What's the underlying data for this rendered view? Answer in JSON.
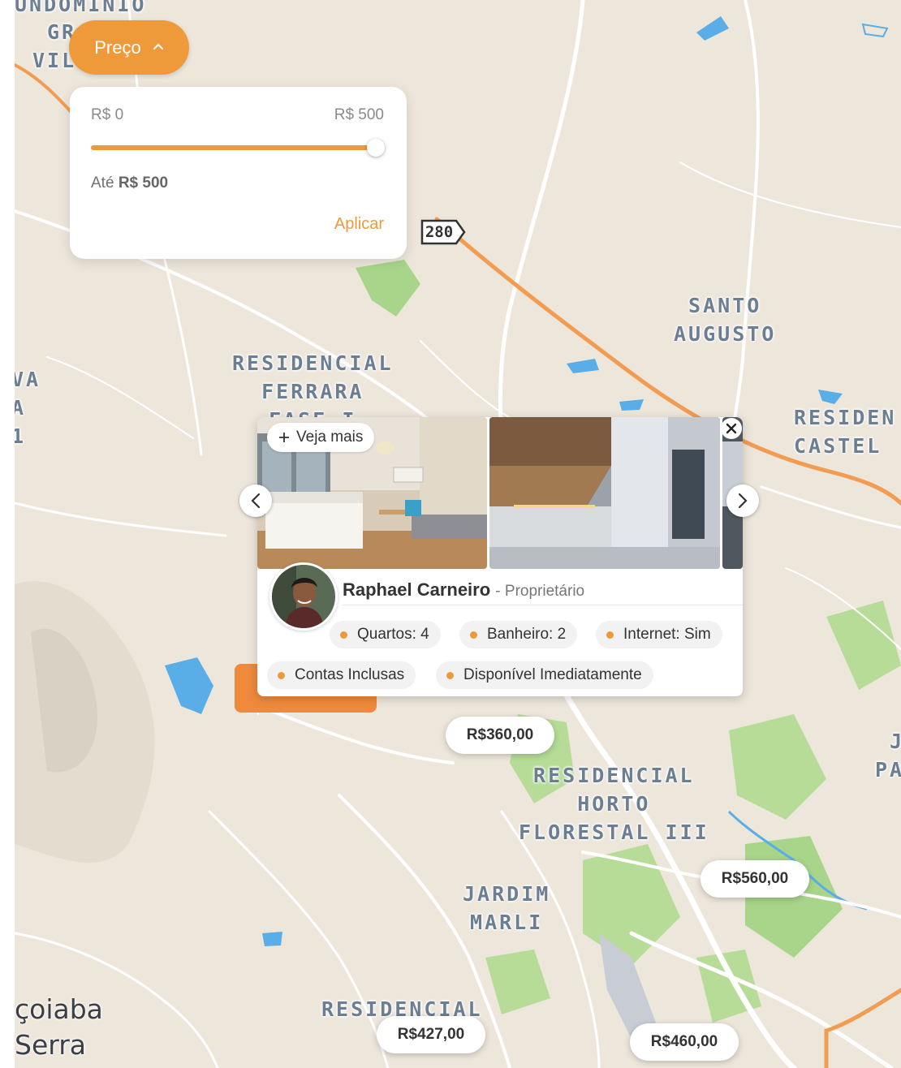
{
  "filter": {
    "button_label": "Preço",
    "min_label": "R$ 0",
    "max_label": "R$ 500",
    "slider_value": 500,
    "slider_max": 500,
    "ate_prefix": "Até",
    "ate_value": "R$ 500",
    "apply_label": "Aplicar"
  },
  "map": {
    "labels": [
      {
        "text": "UNDOMINIO"
      },
      {
        "text": "GR"
      },
      {
        "text": "VIL"
      },
      {
        "text": "RESIDENCIAL\nFERRARA\nFASE I"
      },
      {
        "text": "SANTO\nAUGUSTO"
      },
      {
        "text": "RESIDEN\nCASTEL"
      },
      {
        "text": "VA\nA\n1"
      },
      {
        "text": "RESIDENCIAL\nHORTO\nFLORESTAL III"
      },
      {
        "text": "JARDIM\nMARLI"
      },
      {
        "text": "RESIDENCIAL\nL"
      },
      {
        "text": "J\nPA"
      }
    ],
    "city_label": "çoiaba\nSerra",
    "road_shield": "280",
    "colors": {
      "land": "#ede6db",
      "road": "#ffffff",
      "highway": "#f29c52",
      "park": "#a8d58a",
      "water": "#5aaee8",
      "label": "#6c7e92",
      "accent": "#ef9a3a"
    }
  },
  "pins": [
    {
      "label": "R$360,00"
    },
    {
      "label": "R$560,00"
    },
    {
      "label": "R$427,00"
    },
    {
      "label": "R$460,00"
    }
  ],
  "card": {
    "veja_mais": "Veja mais",
    "owner_name": "Raphael Carneiro",
    "owner_role": "- Proprietário",
    "features": [
      {
        "label": "Quartos: 4"
      },
      {
        "label": "Banheiro: 2"
      },
      {
        "label": "Internet: Sim"
      },
      {
        "label": "Contas Inclusas"
      },
      {
        "label": "Disponível Imediatamente"
      }
    ]
  },
  "icons": [
    "chevron-up-icon",
    "plus-icon",
    "chevron-left-icon",
    "chevron-right-icon",
    "close-icon",
    "dot-icon",
    "road-shield-icon"
  ]
}
